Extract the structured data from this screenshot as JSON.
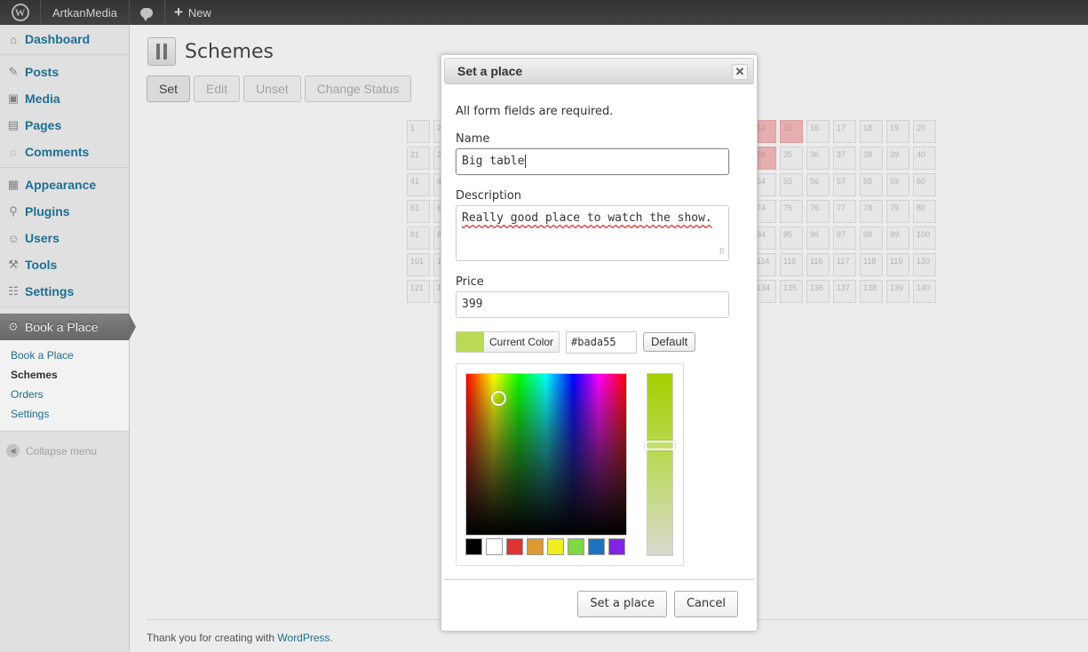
{
  "adminbar": {
    "site_name": "ArtkanMedia",
    "new_label": "New"
  },
  "sidebar": {
    "items": [
      {
        "label": "Dashboard",
        "icon": "dashboard-icon"
      },
      {
        "label": "Posts",
        "icon": "pin-icon"
      },
      {
        "label": "Media",
        "icon": "media-icon"
      },
      {
        "label": "Pages",
        "icon": "pages-icon"
      },
      {
        "label": "Comments",
        "icon": "comment-icon"
      },
      {
        "label": "Appearance",
        "icon": "appearance-icon"
      },
      {
        "label": "Plugins",
        "icon": "plugin-icon"
      },
      {
        "label": "Users",
        "icon": "users-icon"
      },
      {
        "label": "Tools",
        "icon": "tools-icon"
      },
      {
        "label": "Settings",
        "icon": "settings-icon"
      }
    ],
    "current": {
      "label": "Book a Place",
      "icon": "gear-icon"
    },
    "submenu": [
      "Book a Place",
      "Schemes",
      "Orders",
      "Settings"
    ],
    "submenu_active": "Schemes",
    "collapse_label": "Collapse menu"
  },
  "page": {
    "title": "Schemes",
    "toolbar": {
      "set": "Set",
      "edit": "Edit",
      "unset": "Unset",
      "change_status": "Change Status"
    }
  },
  "grid": {
    "columns": 20,
    "rows": 7,
    "visible_numbers": [
      [
        1,
        2,
        14,
        15,
        16,
        17,
        18,
        19,
        20
      ],
      [
        21,
        22,
        34,
        35,
        36,
        37,
        38,
        39,
        40
      ],
      [
        41,
        42,
        54,
        55,
        56,
        57,
        58,
        59,
        60
      ],
      [
        61,
        62,
        74,
        75,
        76,
        77,
        78,
        79,
        80
      ],
      [
        81,
        82,
        94,
        95,
        96,
        97,
        98,
        99,
        100
      ],
      [
        101,
        102,
        114,
        115,
        116,
        117,
        118,
        119,
        120
      ],
      [
        121,
        122,
        134,
        135,
        136,
        137,
        138,
        139,
        140
      ]
    ],
    "booked": [
      14,
      15,
      34
    ],
    "booked_color": "#f2b9b9"
  },
  "footer": {
    "text": "Thank you for creating with ",
    "link": "WordPress",
    "suffix": "."
  },
  "dialog": {
    "title": "Set a place",
    "close_icon": "close-icon",
    "intro": "All form fields are required.",
    "name_label": "Name",
    "name_value": "Big table",
    "description_label": "Description",
    "description_value": "Really good place to watch the show.",
    "price_label": "Price",
    "price_value": "399",
    "current_color_label": "Current Color",
    "hex_value": "#bada55",
    "default_label": "Default",
    "palette": [
      "#000000",
      "#ffffff",
      "#dd3333",
      "#dd9933",
      "#eeee22",
      "#81d742",
      "#1e73be",
      "#8224e3"
    ],
    "submit_label": "Set a place",
    "cancel_label": "Cancel"
  },
  "colors": {
    "accent": "#21759b",
    "picked": "#bada55"
  }
}
